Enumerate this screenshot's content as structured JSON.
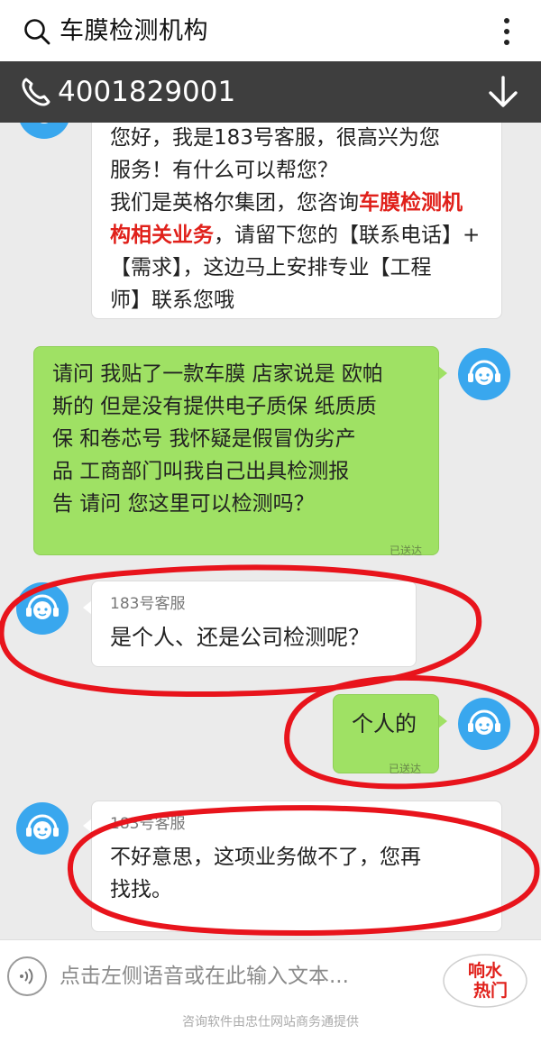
{
  "search": {
    "query": "车膜检测机构"
  },
  "phone_bar": {
    "number": "4001829001"
  },
  "messages": {
    "m1": {
      "lines": [
        "您好，我是183号客服，很高兴为您",
        "服务！有什么可以帮您？"
      ],
      "l3_pre": "我们是英格尔集团，您咨询",
      "l3_red": "车膜检测机",
      "l4_red": "构相关业务",
      "l4_post": "，请留下您的【联系电话】+",
      "l5": "【需求】，这边马上安排专业【工程",
      "l6": "师】联系您哦"
    },
    "m2": {
      "lines": [
        "请问 我贴了一款车膜 店家说是 欧帕",
        "斯的 但是没有提供电子质保 纸质质",
        "保 和卷芯号 我怀疑是假冒伪劣产",
        "品 工商部门叫我自己出具检测报",
        "告 请问 您这里可以检测吗？"
      ],
      "status": "已送达"
    },
    "m3": {
      "sender": "183号客服",
      "text": "是个人、还是公司检测呢？"
    },
    "m4": {
      "text": "个人的",
      "status": "已送达"
    },
    "m5": {
      "sender": "183号客服",
      "lines": [
        "不好意思，这项业务做不了，您再",
        "找找。"
      ]
    }
  },
  "input": {
    "placeholder": "点击左侧语音或在此输入文本..."
  },
  "logo": {
    "text": "响水热门"
  },
  "footer": {
    "text": "咨询软件由忠仕网站商务通提供"
  },
  "colors": {
    "outgoing_bubble": "#9fe164",
    "avatar": "#39a7ee",
    "annotation": "#e8141c",
    "highlight_text": "#e0201a"
  }
}
